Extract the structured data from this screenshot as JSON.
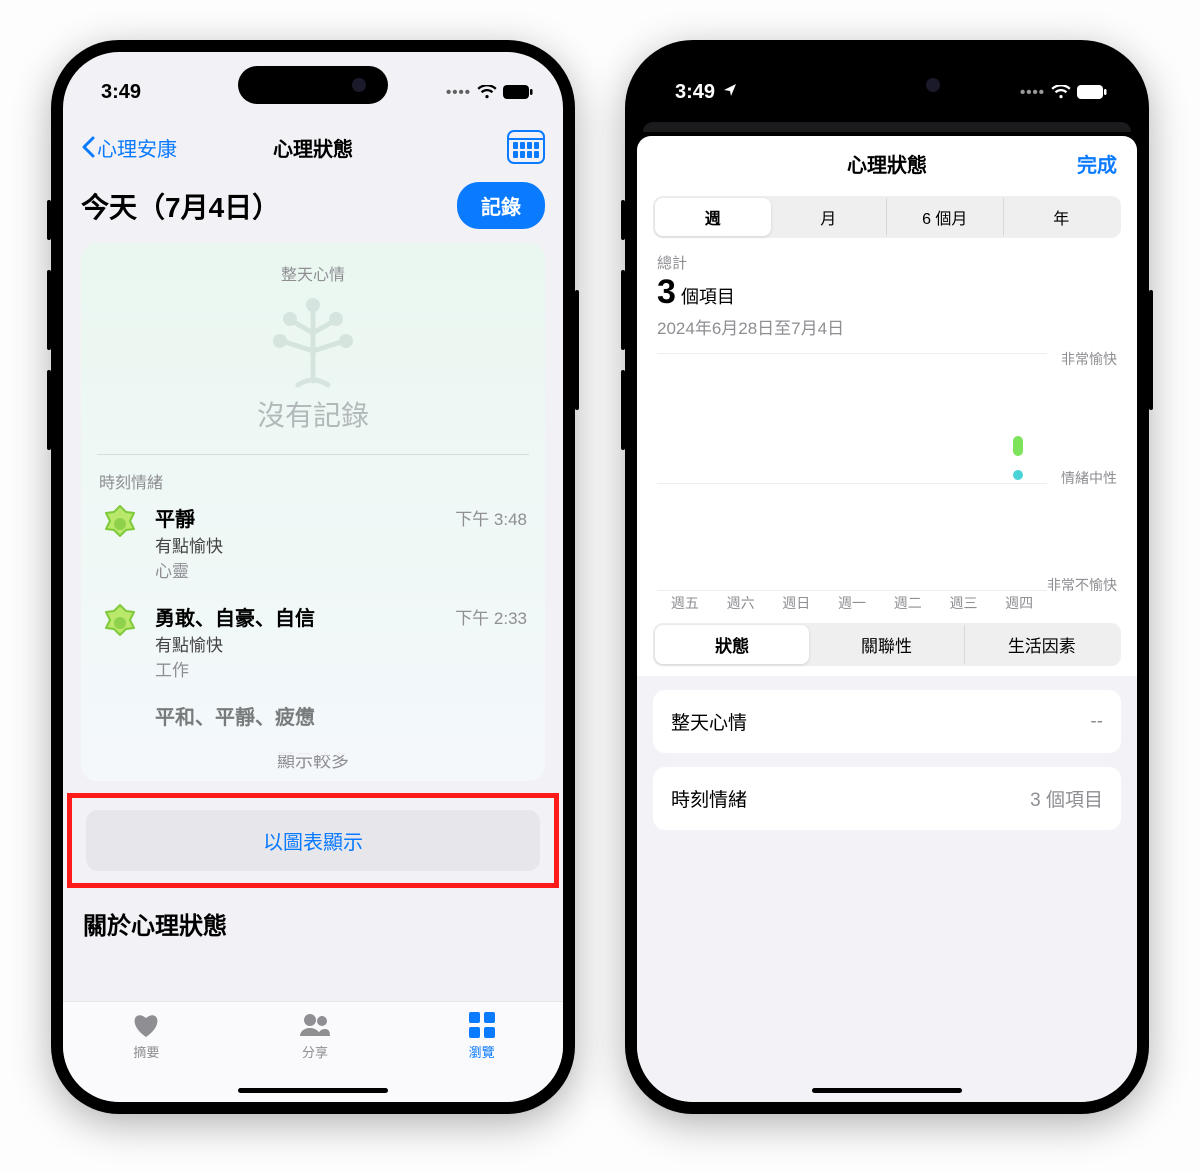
{
  "left": {
    "status_time": "3:49",
    "nav_back": "心理安康",
    "nav_title": "心理狀態",
    "today_title": "今天（7月4日）",
    "record_btn": "記錄",
    "allday_label": "整天心情",
    "no_record": "沒有記錄",
    "moments_label": "時刻情緒",
    "entries": [
      {
        "title": "平靜",
        "sub": "有點愉快",
        "tag": "心靈",
        "time": "下午 3:48"
      },
      {
        "title": "勇敢、自豪、自信",
        "sub": "有點愉快",
        "tag": "工作",
        "time": "下午 2:33"
      },
      {
        "title": "平和、平靜、疲憊",
        "sub": "",
        "tag": "",
        "time": ""
      }
    ],
    "show_more": "顯示較多",
    "chart_btn": "以圖表顯示",
    "about": "關於心理狀態",
    "tabs": {
      "summary": "摘要",
      "share": "分享",
      "browse": "瀏覽"
    }
  },
  "right": {
    "status_time": "3:49",
    "nav_title": "心理狀態",
    "done": "完成",
    "seg1": [
      "週",
      "月",
      "6 個月",
      "年"
    ],
    "sum_label": "總計",
    "sum_count": "3",
    "sum_unit": "個項目",
    "date_range": "2024年6月28日至7月4日",
    "y_labels": {
      "top": "非常愉快",
      "mid": "情緒中性",
      "bot": "非常不愉快"
    },
    "x_labels": [
      "週五",
      "週六",
      "週日",
      "週一",
      "週二",
      "週三",
      "週四"
    ],
    "seg2": [
      "狀態",
      "關聯性",
      "生活因素"
    ],
    "rows": [
      {
        "label": "整天心情",
        "value": "--"
      },
      {
        "label": "時刻情緒",
        "value": "3 個項目"
      }
    ]
  },
  "chart_data": {
    "type": "scatter",
    "title": "心理狀態",
    "xlabel": "",
    "ylabel": "",
    "x_categories": [
      "週五",
      "週六",
      "週日",
      "週一",
      "週二",
      "週三",
      "週四"
    ],
    "y_scale_labels": [
      "非常不愉快",
      "情緒中性",
      "非常愉快"
    ],
    "ylim": [
      -1,
      1
    ],
    "series": [
      {
        "name": "時刻情緒",
        "points": [
          {
            "x": "週四",
            "y": 0.22
          },
          {
            "x": "週四",
            "y": 0.18
          },
          {
            "x": "週四",
            "y": 0.04
          }
        ]
      }
    ],
    "date_range": "2024-06-28 至 2024-07-04",
    "total_items": 3
  }
}
